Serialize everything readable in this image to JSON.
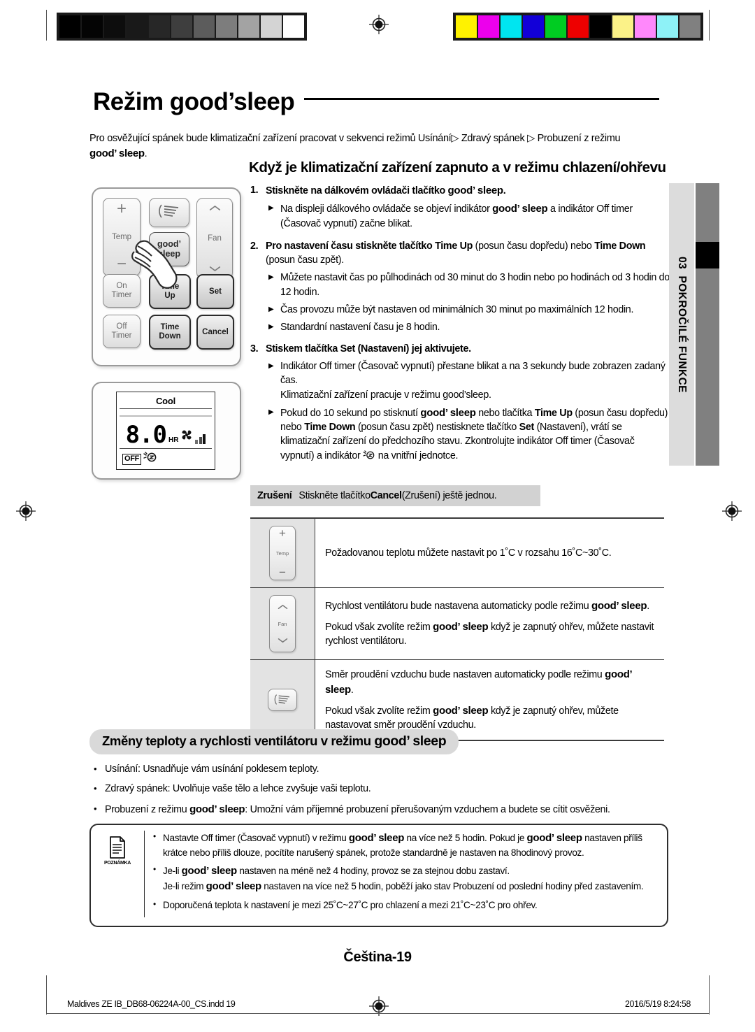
{
  "calibration": {
    "gray_swatches": [
      "#000000",
      "#040404",
      "#0d0d0d",
      "#191919",
      "#272727",
      "#3e3e3e",
      "#5c5c5c",
      "#7d7d7d",
      "#a3a3a3",
      "#d4d4d4",
      "#ffffff"
    ],
    "color_swatches": [
      "#fff200",
      "#ec00ec",
      "#00e5f0",
      "#1200d8",
      "#00cc22",
      "#ee0000",
      "#000000",
      "#fbf288",
      "#ff88fb",
      "#8ef2f7",
      "#808080"
    ]
  },
  "header": {
    "title": "Režim good’sleep",
    "intro_line1": "Pro osvěžující spánek bude klimatizační zařízení pracovat v sekvenci režimů Usínání",
    "intro_arrow1": "▷",
    "intro_mid": " Zdravý spánek ",
    "intro_arrow2": "▷",
    "intro_line2": " Probuzení z režimu",
    "intro_gs": "good’ sleep",
    "intro_period": ".",
    "section_heading": "Když je klimatizační zařízení zapnuto a v režimu chlazení/ohřevu"
  },
  "remote": {
    "temp_plus": "+",
    "temp_label": "Temp",
    "temp_minus": "−",
    "fan_label": "Fan",
    "good_line1": "good’",
    "good_line2": "sleep",
    "on_timer_l1": "On",
    "on_timer_l2": "Timer",
    "time_up_l1": "Time",
    "time_up_l2": "Up",
    "set_label": "Set",
    "off_timer_l1": "Off",
    "off_timer_l2": "Timer",
    "time_down_l1": "Time",
    "time_down_l2": "Down",
    "cancel_label": "Cancel"
  },
  "lcd": {
    "mode": "Cool",
    "value": "8.0",
    "unit": "HR",
    "off_badge": "OFF"
  },
  "steps": [
    {
      "num": "1.",
      "text_pre": "Stiskněte na dálkovém ovládači tlačítko ",
      "text_gs": "good’ sleep",
      "text_post": ".",
      "subs": [
        {
          "pre": "Na displeji dálkového ovládače se objeví indikátor ",
          "gs": "good’ sleep",
          "post": " a indikátor Off timer (Časovač vypnutí) začne blikat."
        }
      ]
    },
    {
      "num": "2.",
      "text_pre": "Pro nastavení času stiskněte tlačítko ",
      "bold1": "Time Up",
      "mid1": " (posun času dopředu) nebo ",
      "bold2": "Time Down",
      "post": " (posun času zpět).",
      "subs": [
        {
          "plain": "Můžete nastavit čas po půlhodinách od 30 minut do 3 hodin nebo po hodinách od 3 hodin do 12 hodin."
        },
        {
          "plain": "Čas provozu může být nastaven od minimálních 30 minut po maximálních 12 hodin."
        },
        {
          "plain": "Standardní nastavení času je 8 hodin."
        }
      ]
    },
    {
      "num": "3.",
      "text_pre": "Stiskem tlačítka ",
      "bold1": "Set",
      "post": " (Nastavení) jej aktivujete.",
      "subs": [
        {
          "plain": "Indikátor Off timer (Časovač vypnutí) přestane blikat a na 3 sekundy bude zobrazen zadaný čas.\nKlimatizační zařízení pracuje v režimu good’sleep."
        },
        {
          "pre": "Pokud do 10 sekund po stisknutí ",
          "gs": "good’ sleep",
          "mid1": " nebo tlačítka ",
          "bold1": "Time Up",
          "mid2": " (posun času dopředu) nebo ",
          "bold2": "Time Down",
          "mid3": " (posun času zpět)  nestisknete tlačítko ",
          "bold3": "Set",
          "post": " (Nastavení), vrátí se klimatizační zařízení do předchozího stavu.  Zkontrolujte indikátor Off timer (Časovač vypnutí) a indikátor ",
          "post2": " na vnitřní jednotce."
        }
      ]
    }
  ],
  "cancel_bar": {
    "label": "Zrušení",
    "pre": "Stiskněte tlačítko ",
    "bold": "Cancel",
    "post": " (Zrušení) ještě jednou."
  },
  "feature_table": [
    {
      "icon": "temp-button-icon",
      "lines": [
        {
          "plain": "Požadovanou teplotu můžete nastavit po 1˚C  v rozsahu 16˚C~30˚C."
        }
      ]
    },
    {
      "icon": "fan-button-icon",
      "lines": [
        {
          "pre": "Rychlost ventilátoru bude nastavena automaticky podle režimu ",
          "gs": "good’ sleep",
          "post": "."
        },
        {
          "pre": "Pokud však zvolíte režim ",
          "gs": "good’ sleep",
          "post": " když je zapnutý ohřev, můžete nastavit rychlost ventilátoru."
        }
      ]
    },
    {
      "icon": "swing-button-icon",
      "lines": [
        {
          "pre": "Směr proudění vzduchu bude nastaven automaticky podle režimu ",
          "gs": "good’ sleep",
          "post": "."
        },
        {
          "pre": "Pokud však zvolíte režim ",
          "gs": "good’ sleep",
          "post": " když je zapnutý ohřev, můžete nastavovat směr proudění vzduchu."
        }
      ]
    }
  ],
  "second_section": {
    "pill_pre": "Změny teploty a rychlosti ventilátoru v režimu ",
    "pill_gs": "good’ sleep",
    "bullets": [
      {
        "plain": "Usínání: Usnadňuje vám usínání poklesem teploty."
      },
      {
        "plain": "Zdravý spánek: Uvolňuje vaše tělo a lehce zvyšuje vaši teplotu."
      },
      {
        "pre": "Probuzení z režimu ",
        "gs": "good’ sleep",
        "post": ": Umožní vám příjemné probuzení  přerušovaným vzduchem a budete se cítit osvěženi."
      }
    ]
  },
  "note": {
    "icon_label": "POZNÁMKA",
    "items": [
      {
        "pre": "Nastavte Off timer (Časovač vypnutí) v režimu ",
        "gs": "good’ sleep",
        "mid": " na více než 5 hodin. Pokud je ",
        "gs2": "good’ sleep",
        "post": " nastaven příliš krátce nebo příliš dlouze, pocítíte narušený spánek, protože standardně je nastaven na 8hodinový provoz."
      },
      {
        "pre": "Je-li ",
        "gs": "good’ sleep",
        "post": " nastaven na méně než 4 hodiny, provoz se za stejnou dobu zastaví.",
        "extra_pre": "Je-li režim ",
        "extra_gs": "good’ sleep",
        "extra_post": " nastaven na více než 5 hodin, poběží jako stav Probuzení od poslední hodiny před zastavením."
      },
      {
        "plain": "Doporučená teplota k nastavení je mezi 25˚C~27˚C pro chlazení a mezi 21˚C~23˚C pro ohřev."
      }
    ]
  },
  "sidebar": {
    "chapter_number": "03",
    "chapter_label": "POKROČILÉ FUNKCE"
  },
  "footer": {
    "folio": "Čeština-19",
    "file_info": "Maldives ZE IB_DB68-06224A-00_CS.indd   19",
    "timestamp": "2016/5/19   8:24:58"
  }
}
